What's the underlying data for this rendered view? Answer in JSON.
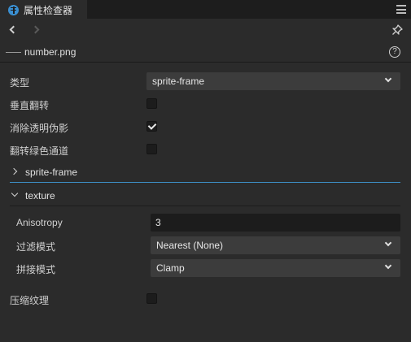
{
  "colors": {
    "accent": "#3a8fd1",
    "section_line_active": "#3d8fc6",
    "section_line": "#1c1c1c"
  },
  "tab": {
    "title": "属性检查器",
    "icon": "inspector-icon"
  },
  "toolbar": {
    "menu_icon": "hamburger-menu-icon",
    "back_icon": "chevron-left-icon",
    "forward_icon": "chevron-right-icon",
    "pin_icon": "pin-icon"
  },
  "file": {
    "name": "number.png",
    "help_icon": "help-icon"
  },
  "props": {
    "type": {
      "label": "类型",
      "value": "sprite-frame"
    },
    "flip_vertical": {
      "label": "垂直翻转",
      "checked": false
    },
    "remove_alpha_fringe": {
      "label": "消除透明伪影",
      "checked": true
    },
    "flip_green": {
      "label": "翻转绿色通道",
      "checked": false
    }
  },
  "sections": {
    "sprite_frame": {
      "label": "sprite-frame",
      "expanded": false
    },
    "texture": {
      "label": "texture",
      "expanded": true
    }
  },
  "texture": {
    "anisotropy": {
      "label": "Anisotropy",
      "value": "3"
    },
    "filter_mode": {
      "label": "过滤模式",
      "value": "Nearest (None)"
    },
    "wrap_mode": {
      "label": "拼接模式",
      "value": "Clamp"
    }
  },
  "compress": {
    "label": "压缩纹理",
    "checked": false
  }
}
